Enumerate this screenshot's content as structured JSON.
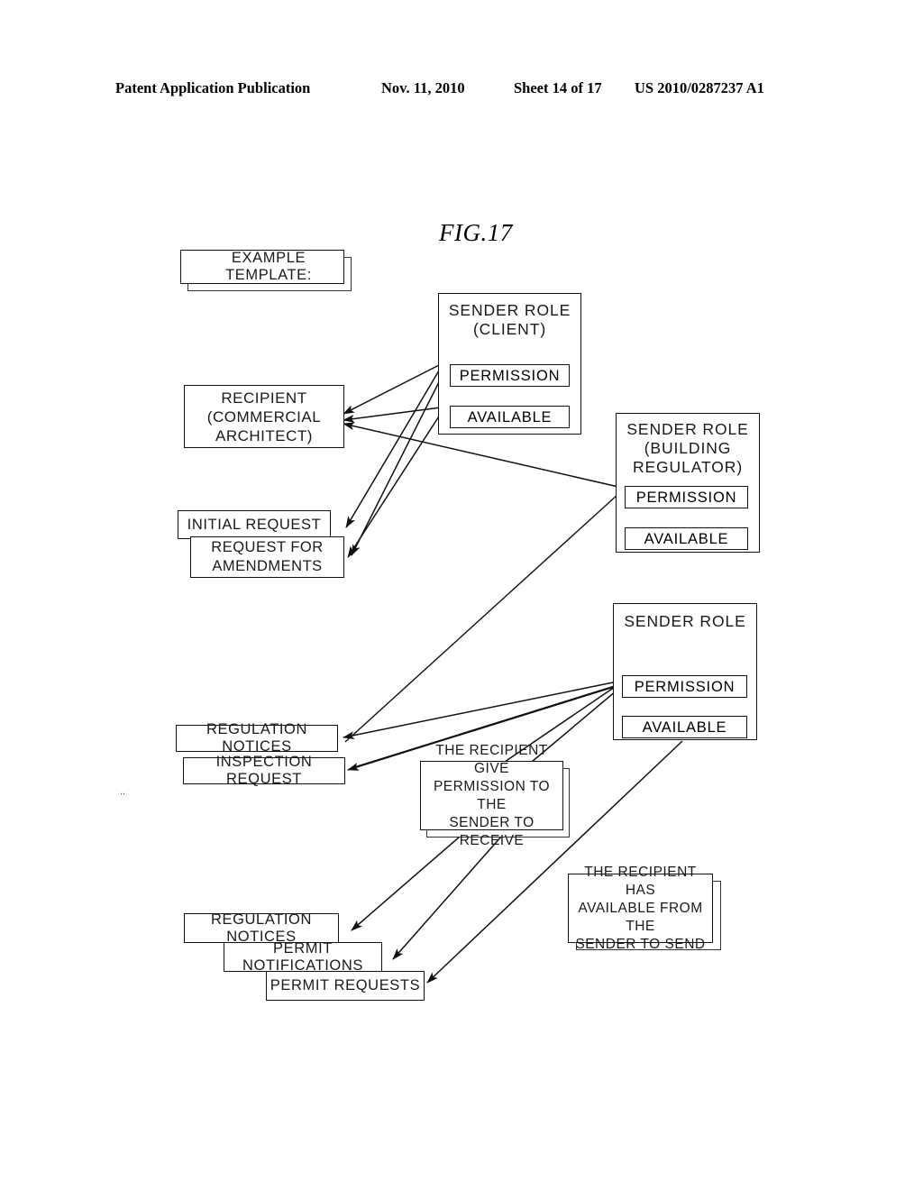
{
  "header": {
    "publication": "Patent Application Publication",
    "date": "Nov. 11, 2010",
    "sheet": "Sheet 14 of 17",
    "number": "US 2010/0287237 A1"
  },
  "figure": {
    "label": "FIG.17",
    "caption_box": "EXAMPLE TEMPLATE:"
  },
  "nodes": {
    "example_template": "EXAMPLE TEMPLATE:",
    "sender_client": {
      "title": "SENDER ROLE\n(CLIENT)",
      "permission": "PERMISSION",
      "available": "AVAILABLE"
    },
    "sender_regulator": {
      "title": "SENDER ROLE\n(BUILDING\nREGULATOR)",
      "permission": "PERMISSION",
      "available": "AVAILABLE"
    },
    "sender_plain": {
      "title": "SENDER ROLE",
      "permission": "PERMISSION",
      "available": "AVAILABLE"
    },
    "recipient": "RECIPIENT\n(COMMERCIAL\nARCHITECT)",
    "initial_request": "INITIAL REQUEST",
    "request_amendments": "REQUEST FOR\nAMENDMENTS",
    "regulation_notices_top": "REGULATION NOTICES",
    "inspection_request": "INSPECTION REQUEST",
    "recipient_give": "THE RECIPIENT GIVE\nPERMISSION TO THE\nSENDER TO RECEIVE",
    "recipient_has": "THE RECIPIENT HAS\nAVAILABLE FROM THE\nSENDER TO SEND",
    "regulation_notices_bottom": "REGULATION NOTICES",
    "permit_notifications": "PERMIT NOTIFICATIONS",
    "permit_requests": "PERMIT REQUESTS"
  },
  "diagram_meta": {
    "type": "diagram",
    "stroke_color": "#111111",
    "background_color": "#ffffff",
    "edges": [
      {
        "from": "sender_client.permission",
        "to": "recipient"
      },
      {
        "from": "sender_client.available",
        "to": "recipient"
      },
      {
        "from": "sender_regulator.permission",
        "to": "recipient"
      },
      {
        "from": "sender_client.permission",
        "to": "initial_request"
      },
      {
        "from": "sender_client.permission",
        "to": "request_amendments"
      },
      {
        "from": "sender_client.available",
        "to": "request_amendments"
      },
      {
        "from": "sender_plain.permission",
        "to": "regulation_notices_top"
      },
      {
        "from": "sender_plain.permission",
        "to": "inspection_request"
      },
      {
        "from": "sender_regulator.permission",
        "to": "initial_request"
      },
      {
        "from": "recipient_give",
        "to": "regulation_notices_bottom"
      },
      {
        "from": "recipient_give",
        "to": "permit_notifications"
      },
      {
        "from": "sender_plain.available",
        "to": "permit_requests"
      },
      {
        "from": "sender_plain.permission",
        "to": "recipient_give"
      }
    ]
  }
}
